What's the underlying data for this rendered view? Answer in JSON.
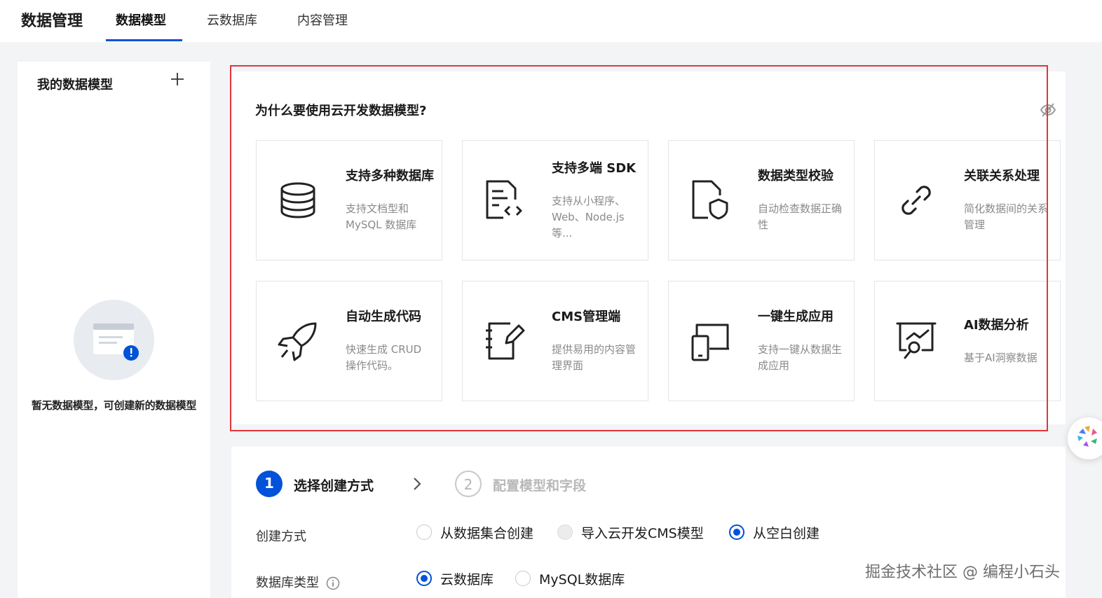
{
  "header": {
    "app_title": "数据管理",
    "tabs": [
      {
        "label": "数据模型",
        "active": true
      },
      {
        "label": "云数据库",
        "active": false
      },
      {
        "label": "内容管理",
        "active": false
      }
    ]
  },
  "sidebar": {
    "title": "我的数据模型",
    "add_icon": "plus-icon",
    "empty_text": "暂无数据模型，可创建新的数据模型"
  },
  "features": {
    "title": "为什么要使用云开发数据模型?",
    "hide_icon": "eye-off-icon",
    "cards": [
      {
        "title": "支持多种数据库",
        "desc": "支持文档型和 MySQL 数据库",
        "icon": "database-icon"
      },
      {
        "title": "支持多端 SDK",
        "desc": "支持从小程序、Web、Node.js 等...",
        "icon": "code-file-icon"
      },
      {
        "title": "数据类型校验",
        "desc": "自动检查数据正确性",
        "icon": "shield-file-icon"
      },
      {
        "title": "关联关系处理",
        "desc": "简化数据间的关系管理",
        "icon": "link-icon"
      },
      {
        "title": "自动生成代码",
        "desc": "快速生成 CRUD 操作代码。",
        "icon": "rocket-icon"
      },
      {
        "title": "CMS管理端",
        "desc": "提供易用的内容管理界面",
        "icon": "notebook-edit-icon"
      },
      {
        "title": "一键生成应用",
        "desc": "支持一键从数据生成应用",
        "icon": "devices-icon"
      },
      {
        "title": "AI数据分析",
        "desc": "基于AI洞察数据",
        "icon": "analysis-icon"
      }
    ]
  },
  "stepper": {
    "steps": [
      {
        "number": "1",
        "label": "选择创建方式",
        "active": true
      },
      {
        "number": "2",
        "label": "配置模型和字段",
        "active": false
      }
    ]
  },
  "form": {
    "create_method": {
      "label": "创建方式",
      "options": [
        {
          "label": "从数据集合创建",
          "checked": false,
          "disabled": false
        },
        {
          "label": "导入云开发CMS模型",
          "checked": false,
          "disabled": true
        },
        {
          "label": "从空白创建",
          "checked": true,
          "disabled": false
        }
      ]
    },
    "db_type": {
      "label": "数据库类型",
      "options": [
        {
          "label": "云数据库",
          "checked": true
        },
        {
          "label": "MySQL数据库",
          "checked": false
        }
      ]
    }
  },
  "watermark": "掘金技术社区 @ 编程小石头",
  "colors": {
    "primary": "#0052d9",
    "highlight_border": "#e0363c"
  }
}
